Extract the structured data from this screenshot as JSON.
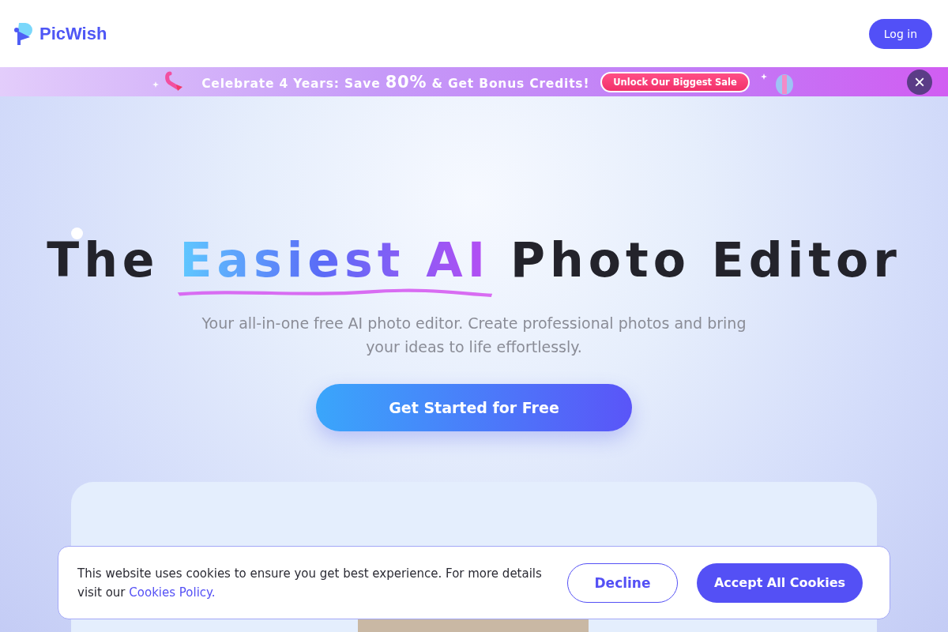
{
  "header": {
    "brand": "PicWish",
    "login": "Log in"
  },
  "promo": {
    "text": "Celebrate 4 Years: Save **80%** & Get Bonus Credits!",
    "cta": "Unlock Our Biggest Sale",
    "close": "×"
  },
  "hero": {
    "headline": [
      {
        "text": "The",
        "kind": "plain"
      },
      {
        "text": "Easiest AI",
        "kind": "highlight"
      },
      {
        "text": "Photo Editor",
        "kind": "plain"
      }
    ],
    "subtitle": "Your all-in-one free AI photo editor. Create professional photos and bring your ideas to life effortlessly.",
    "cta": "Get Started for Free"
  },
  "cookie_banner": {
    "text": "This website uses cookies to ensure you get best experience. For more details visit our",
    "link": "Cookies Policy.",
    "decline": "Decline",
    "accept": "Accept All Cookies"
  }
}
